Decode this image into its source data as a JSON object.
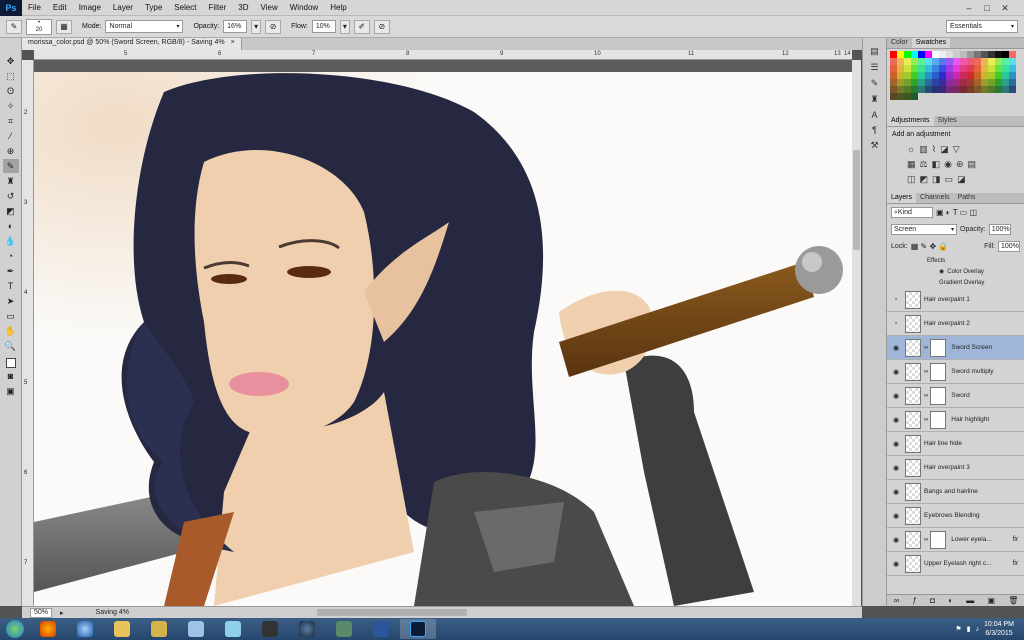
{
  "menu": {
    "logo": "Ps",
    "items": [
      "File",
      "Edit",
      "Image",
      "Layer",
      "Type",
      "Select",
      "Filter",
      "3D",
      "View",
      "Window",
      "Help"
    ],
    "window_controls": [
      "–",
      "□",
      "✕"
    ]
  },
  "options": {
    "brush_size": "20",
    "mode_label": "Mode:",
    "mode_value": "Normal",
    "opacity_label": "Opacity:",
    "opacity_value": "16%",
    "flow_label": "Flow:",
    "flow_value": "10%",
    "workspace": "Essentials"
  },
  "document": {
    "tab_title": "morissa_color.psd @ 50% (Sword Screen, RGB/8) - Saving 4%",
    "close": "×",
    "ruler_top": [
      "5",
      "6",
      "7",
      "8",
      "9",
      "10",
      "11",
      "12",
      "13",
      "14"
    ],
    "ruler_left": [
      "2",
      "3",
      "4",
      "5",
      "6",
      "7"
    ]
  },
  "status": {
    "zoom": "50%",
    "saving": "Saving 4%"
  },
  "panels": {
    "color_tab": "Color",
    "swatches_tab": "Swatches",
    "adjustments_tab": "Adjustments",
    "styles_tab": "Styles",
    "add_adjustment": "Add an adjustment",
    "layers_tab": "Layers",
    "channels_tab": "Channels",
    "paths_tab": "Paths",
    "kind_label": "Kind",
    "blend_mode": "Screen",
    "opacity_label": "Opacity:",
    "opacity_value": "100%",
    "lock_label": "Lock:",
    "fill_label": "Fill:",
    "fill_value": "100%",
    "effects_header": "Effects",
    "effects": [
      "Color Overlay",
      "Gradient Overlay"
    ],
    "layers": [
      {
        "name": "Hair overpaint 1"
      },
      {
        "name": "Hair overpaint 2"
      },
      {
        "name": "Sword Screen"
      },
      {
        "name": "Sword multiply"
      },
      {
        "name": "Sword"
      },
      {
        "name": "Hair highlight"
      },
      {
        "name": "Hair line hide"
      },
      {
        "name": "Hair overpaint 3"
      },
      {
        "name": "Bangs and hairline"
      },
      {
        "name": "Eyebrows Blending"
      },
      {
        "name": "Lower eyela..."
      },
      {
        "name": "Upper Eyelash right c..."
      }
    ],
    "fx_label": "fx"
  },
  "taskbar": {
    "time": "10:04 PM",
    "date": "6/3/2015"
  },
  "colors": {
    "hair": "#252840",
    "skin": "#f0cfae",
    "selected_layer": "#9fb6d8"
  }
}
